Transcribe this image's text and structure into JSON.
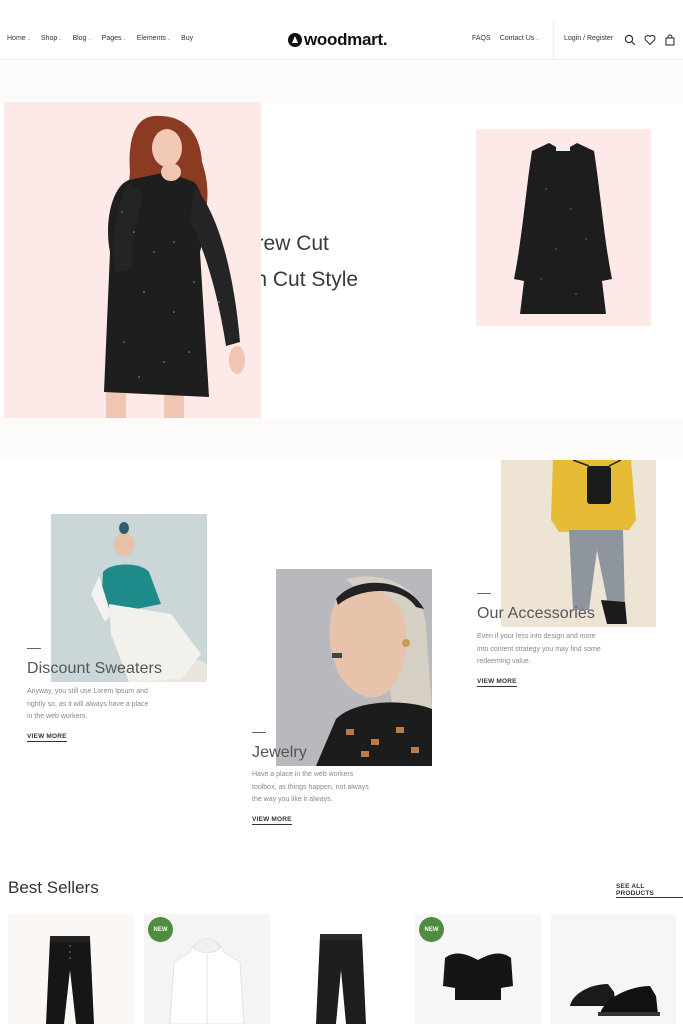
{
  "header": {
    "nav_left": [
      {
        "label": "Home",
        "dropdown": true
      },
      {
        "label": "Shop",
        "dropdown": true
      },
      {
        "label": "Blog",
        "dropdown": true
      },
      {
        "label": "Pages",
        "dropdown": true
      },
      {
        "label": "Elements",
        "dropdown": true
      },
      {
        "label": "Buy",
        "dropdown": false
      }
    ],
    "logo": "woodmart.",
    "nav_right": [
      {
        "label": "FAQS",
        "dropdown": false
      },
      {
        "label": "Contact Us",
        "dropdown": true
      }
    ],
    "login_label": "Login / Register",
    "chevron": "⌄"
  },
  "hero": {
    "title_line1": "Look Crew Cut",
    "title_line2": "Dress in Cut Style"
  },
  "categories": [
    {
      "title": "Discount Sweaters",
      "description": [
        "Anyway, you still use Lorem Ipsum and",
        "rightly so, as it will always have a place",
        "in the web workers."
      ],
      "link": "VIEW MORE"
    },
    {
      "title": "Jewelry",
      "description": [
        "Have a place in the web workers",
        "toolbox, as things happen, not always",
        "the way you like it always."
      ],
      "link": "VIEW MORE"
    },
    {
      "title": "Our Accessories",
      "description": [
        "Even if your less into design and more",
        "into content strategy you may find some",
        "redeeming value."
      ],
      "link": "VIEW MORE"
    }
  ],
  "best_sellers": {
    "title": "Best Sellers",
    "see_all": "SEE ALL PRODUCTS",
    "products": [
      {
        "image": "black-trousers",
        "badge": ""
      },
      {
        "image": "white-hoodie",
        "badge": "NEW"
      },
      {
        "image": "black-jeans",
        "badge": ""
      },
      {
        "image": "black-crop-top",
        "badge": "NEW"
      },
      {
        "image": "black-sneakers",
        "badge": ""
      }
    ]
  },
  "colors": {
    "accent_pink": "#fde9e7",
    "badge_green": "#4e8c3f",
    "text_dark": "#242424"
  }
}
